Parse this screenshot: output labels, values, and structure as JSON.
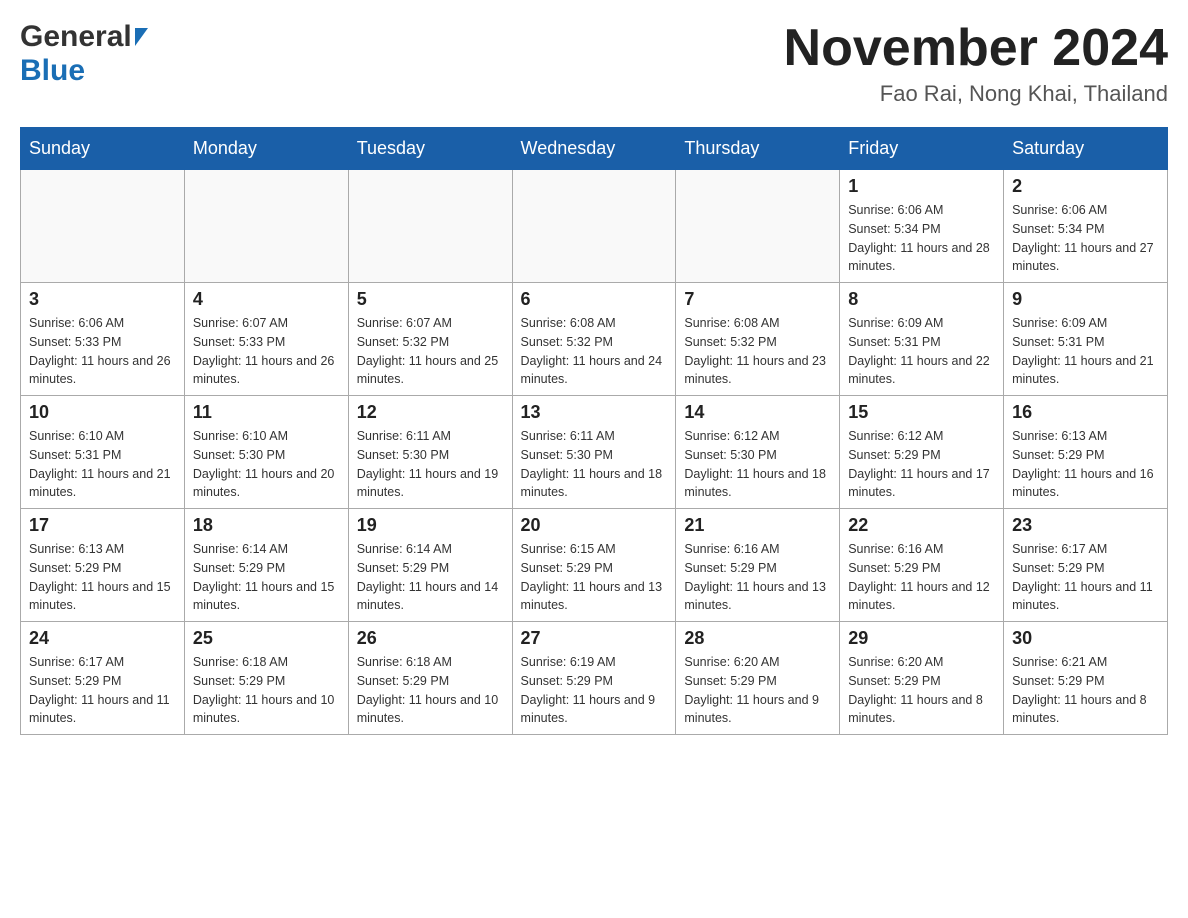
{
  "header": {
    "logo_general": "General",
    "logo_blue": "Blue",
    "month_title": "November 2024",
    "location": "Fao Rai, Nong Khai, Thailand"
  },
  "days_of_week": [
    "Sunday",
    "Monday",
    "Tuesday",
    "Wednesday",
    "Thursday",
    "Friday",
    "Saturday"
  ],
  "weeks": [
    [
      {
        "day": "",
        "info": ""
      },
      {
        "day": "",
        "info": ""
      },
      {
        "day": "",
        "info": ""
      },
      {
        "day": "",
        "info": ""
      },
      {
        "day": "",
        "info": ""
      },
      {
        "day": "1",
        "info": "Sunrise: 6:06 AM\nSunset: 5:34 PM\nDaylight: 11 hours and 28 minutes."
      },
      {
        "day": "2",
        "info": "Sunrise: 6:06 AM\nSunset: 5:34 PM\nDaylight: 11 hours and 27 minutes."
      }
    ],
    [
      {
        "day": "3",
        "info": "Sunrise: 6:06 AM\nSunset: 5:33 PM\nDaylight: 11 hours and 26 minutes."
      },
      {
        "day": "4",
        "info": "Sunrise: 6:07 AM\nSunset: 5:33 PM\nDaylight: 11 hours and 26 minutes."
      },
      {
        "day": "5",
        "info": "Sunrise: 6:07 AM\nSunset: 5:32 PM\nDaylight: 11 hours and 25 minutes."
      },
      {
        "day": "6",
        "info": "Sunrise: 6:08 AM\nSunset: 5:32 PM\nDaylight: 11 hours and 24 minutes."
      },
      {
        "day": "7",
        "info": "Sunrise: 6:08 AM\nSunset: 5:32 PM\nDaylight: 11 hours and 23 minutes."
      },
      {
        "day": "8",
        "info": "Sunrise: 6:09 AM\nSunset: 5:31 PM\nDaylight: 11 hours and 22 minutes."
      },
      {
        "day": "9",
        "info": "Sunrise: 6:09 AM\nSunset: 5:31 PM\nDaylight: 11 hours and 21 minutes."
      }
    ],
    [
      {
        "day": "10",
        "info": "Sunrise: 6:10 AM\nSunset: 5:31 PM\nDaylight: 11 hours and 21 minutes."
      },
      {
        "day": "11",
        "info": "Sunrise: 6:10 AM\nSunset: 5:30 PM\nDaylight: 11 hours and 20 minutes."
      },
      {
        "day": "12",
        "info": "Sunrise: 6:11 AM\nSunset: 5:30 PM\nDaylight: 11 hours and 19 minutes."
      },
      {
        "day": "13",
        "info": "Sunrise: 6:11 AM\nSunset: 5:30 PM\nDaylight: 11 hours and 18 minutes."
      },
      {
        "day": "14",
        "info": "Sunrise: 6:12 AM\nSunset: 5:30 PM\nDaylight: 11 hours and 18 minutes."
      },
      {
        "day": "15",
        "info": "Sunrise: 6:12 AM\nSunset: 5:29 PM\nDaylight: 11 hours and 17 minutes."
      },
      {
        "day": "16",
        "info": "Sunrise: 6:13 AM\nSunset: 5:29 PM\nDaylight: 11 hours and 16 minutes."
      }
    ],
    [
      {
        "day": "17",
        "info": "Sunrise: 6:13 AM\nSunset: 5:29 PM\nDaylight: 11 hours and 15 minutes."
      },
      {
        "day": "18",
        "info": "Sunrise: 6:14 AM\nSunset: 5:29 PM\nDaylight: 11 hours and 15 minutes."
      },
      {
        "day": "19",
        "info": "Sunrise: 6:14 AM\nSunset: 5:29 PM\nDaylight: 11 hours and 14 minutes."
      },
      {
        "day": "20",
        "info": "Sunrise: 6:15 AM\nSunset: 5:29 PM\nDaylight: 11 hours and 13 minutes."
      },
      {
        "day": "21",
        "info": "Sunrise: 6:16 AM\nSunset: 5:29 PM\nDaylight: 11 hours and 13 minutes."
      },
      {
        "day": "22",
        "info": "Sunrise: 6:16 AM\nSunset: 5:29 PM\nDaylight: 11 hours and 12 minutes."
      },
      {
        "day": "23",
        "info": "Sunrise: 6:17 AM\nSunset: 5:29 PM\nDaylight: 11 hours and 11 minutes."
      }
    ],
    [
      {
        "day": "24",
        "info": "Sunrise: 6:17 AM\nSunset: 5:29 PM\nDaylight: 11 hours and 11 minutes."
      },
      {
        "day": "25",
        "info": "Sunrise: 6:18 AM\nSunset: 5:29 PM\nDaylight: 11 hours and 10 minutes."
      },
      {
        "day": "26",
        "info": "Sunrise: 6:18 AM\nSunset: 5:29 PM\nDaylight: 11 hours and 10 minutes."
      },
      {
        "day": "27",
        "info": "Sunrise: 6:19 AM\nSunset: 5:29 PM\nDaylight: 11 hours and 9 minutes."
      },
      {
        "day": "28",
        "info": "Sunrise: 6:20 AM\nSunset: 5:29 PM\nDaylight: 11 hours and 9 minutes."
      },
      {
        "day": "29",
        "info": "Sunrise: 6:20 AM\nSunset: 5:29 PM\nDaylight: 11 hours and 8 minutes."
      },
      {
        "day": "30",
        "info": "Sunrise: 6:21 AM\nSunset: 5:29 PM\nDaylight: 11 hours and 8 minutes."
      }
    ]
  ]
}
